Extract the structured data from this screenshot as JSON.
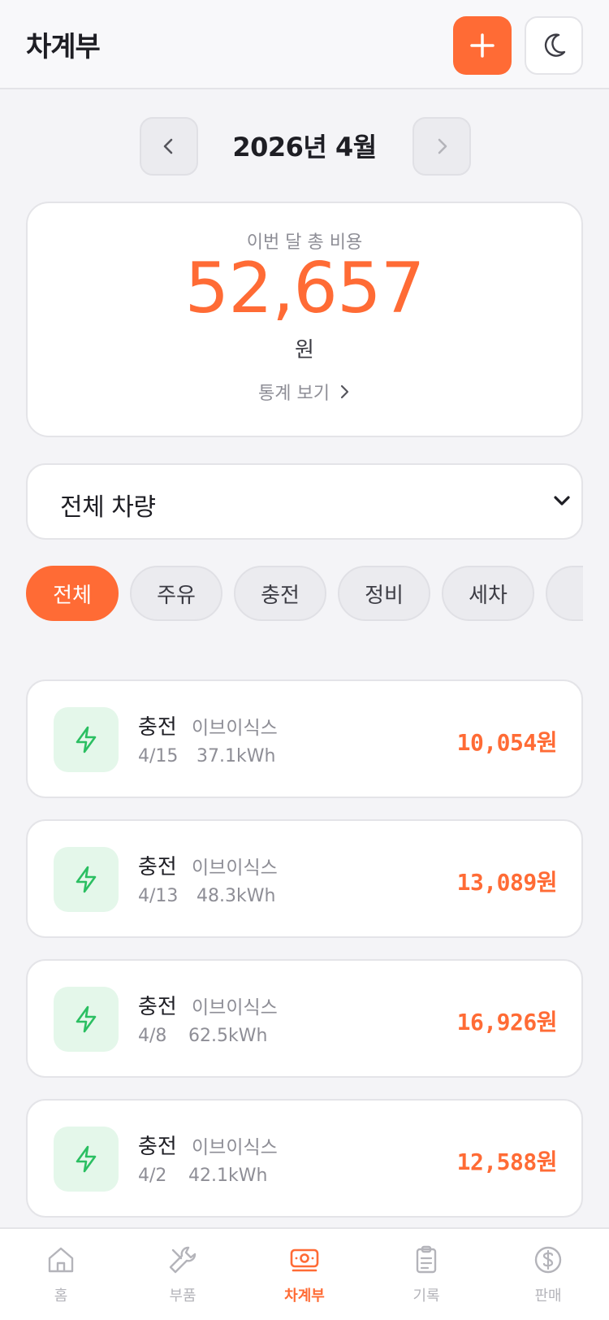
{
  "header": {
    "title": "차계부",
    "add_icon": "plus-icon",
    "theme_icon": "moon-icon"
  },
  "month": {
    "label": "2026년 4월"
  },
  "summary": {
    "label": "이번 달 총 비용",
    "amount": "52,657",
    "unit": "원",
    "stats_link": "통계 보기"
  },
  "vehicle": {
    "selected": "전체 차량"
  },
  "filters": [
    "전체",
    "주유",
    "충전",
    "정비",
    "세차"
  ],
  "colors": {
    "accent": "#FF6B35",
    "charge_icon": "#2BBF62",
    "charge_bg": "#E4F7EA"
  },
  "transactions": [
    {
      "category": "충전",
      "station": "이브이식스",
      "date": "4/15",
      "energy": "37.1kWh",
      "amount": "10,054원"
    },
    {
      "category": "충전",
      "station": "이브이식스",
      "date": "4/13",
      "energy": "48.3kWh",
      "amount": "13,089원"
    },
    {
      "category": "충전",
      "station": "이브이식스",
      "date": "4/8",
      "energy": "62.5kWh",
      "amount": "16,926원"
    },
    {
      "category": "충전",
      "station": "이브이식스",
      "date": "4/2",
      "energy": "42.1kWh",
      "amount": "12,588원"
    }
  ],
  "nav": [
    {
      "label": "홈",
      "icon": "home-icon"
    },
    {
      "label": "부품",
      "icon": "wrench-icon"
    },
    {
      "label": "차계부",
      "icon": "money-icon",
      "active": true
    },
    {
      "label": "기록",
      "icon": "clipboard-icon"
    },
    {
      "label": "판매",
      "icon": "dollar-icon"
    }
  ]
}
